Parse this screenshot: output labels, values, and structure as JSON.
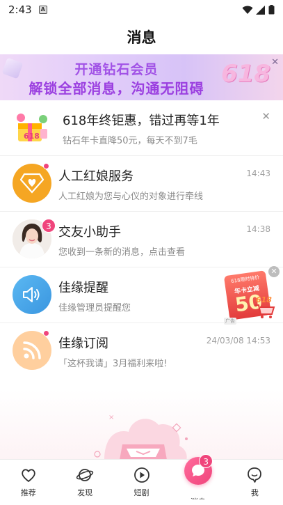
{
  "status_bar": {
    "time": "2:43",
    "notification_letter": "A"
  },
  "header": {
    "title": "消息"
  },
  "banner": {
    "line1": "开通钻石会员",
    "line2": "解锁全部消息，沟通无阻碍",
    "badge_text": "618",
    "close_symbol": "✕"
  },
  "messages": [
    {
      "title": "618年终钜惠，错过再等1年",
      "subtitle": "钻石年卡直降50元，每天不到7毛",
      "time": "",
      "close_symbol": "✕",
      "icon": "gift-618-icon"
    },
    {
      "title": "人工红娘服务",
      "subtitle": "人工红娘为您与心仪的对象进行牵线",
      "time": "14:43",
      "icon": "diamond-heart-icon",
      "unread_dot": true
    },
    {
      "title": "交友小助手",
      "subtitle": "您收到一条新的消息，点击查看",
      "time": "14:38",
      "icon": "assistant-avatar",
      "badge": "3"
    },
    {
      "title": "佳缘提醒",
      "subtitle": "佳缘管理员提醒您",
      "time": "",
      "icon": "speaker-icon"
    },
    {
      "title": "佳缘订阅",
      "subtitle": "「这杯我请」3月福利来啦!",
      "time": "24/03/08 14:53",
      "icon": "rss-icon",
      "unread_dot": true
    }
  ],
  "float_promo": {
    "top_text": "618限时特价",
    "mid_text": "年卡立减",
    "number": "50",
    "badge": "618",
    "ad_label": "广告",
    "close_symbol": "✕"
  },
  "bottom_nav": {
    "items": [
      {
        "label": "推荐",
        "icon": "heart-icon"
      },
      {
        "label": "发现",
        "icon": "planet-icon"
      },
      {
        "label": "短剧",
        "icon": "play-icon"
      },
      {
        "label": "消息",
        "icon": "chat-bubble-icon",
        "badge": "3",
        "active": true
      },
      {
        "label": "我",
        "icon": "profile-icon"
      }
    ]
  },
  "colors": {
    "accent": "#f0457c",
    "banner_text": "#9b3fe0",
    "orange": "#f5a623",
    "blue": "#3fa0e6"
  }
}
